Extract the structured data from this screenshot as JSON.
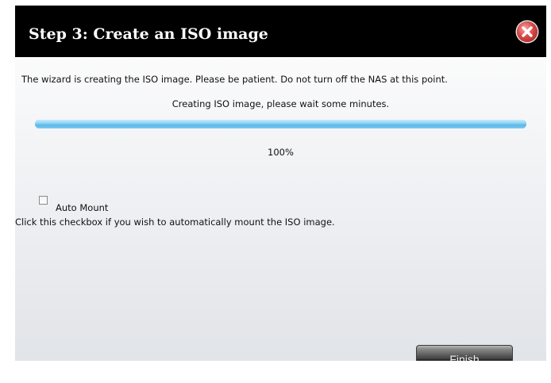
{
  "dialog": {
    "title": "Step 3: Create an ISO image",
    "message": "The wizard is creating the ISO image. Please be patient. Do not turn off the NAS at this point.",
    "status": "Creating ISO image, please wait some minutes.",
    "progress_percent": 100,
    "progress_label": "100%",
    "auto_mount": {
      "label": "Auto Mount",
      "checked": false,
      "hint": "Click this checkbox if you wish to automatically mount the ISO image."
    },
    "finish_label": "Finish"
  },
  "colors": {
    "titlebar_bg": "#000000",
    "title_text": "#ffffff",
    "close_button": "#d94848",
    "progress_fill": "#6cc3ee",
    "finish_button": "#3d3d3d"
  },
  "icons": {
    "close": "close-icon"
  }
}
